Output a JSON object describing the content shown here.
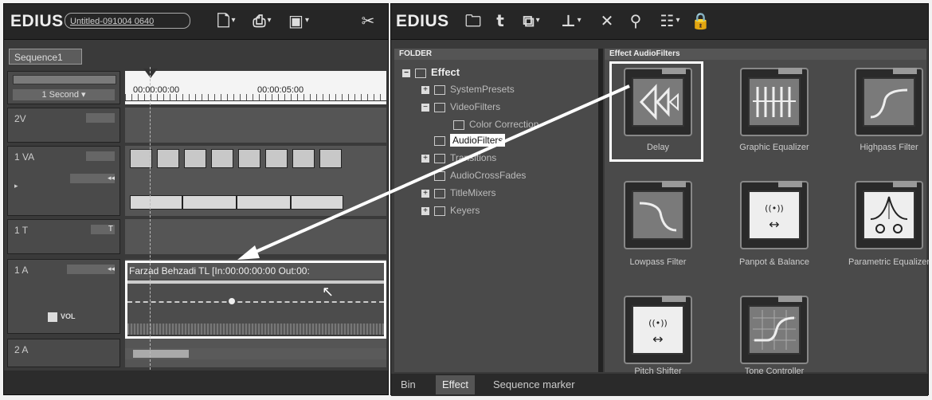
{
  "left_window": {
    "app_title": "EDIUS",
    "project_name": "Untitled-091004 0640",
    "sequence_tab": "Sequence1",
    "scale_label": "1 Second",
    "timecodes": [
      "00:00:00:00",
      "00:00:05:00"
    ],
    "tracks": {
      "t2v": "2V",
      "t1va": "1 VA",
      "t1t": "1 T",
      "t1a": "1 A",
      "t2a": "2 A"
    },
    "vol_label": "VOL",
    "clip_label": "Farzad Behzadi  TL [In:00:00:00:00 Out:00:"
  },
  "right_window": {
    "app_title": "EDIUS",
    "folder_header": "FOLDER",
    "tree": {
      "effect": "Effect",
      "system_presets": "SystemPresets",
      "video_filters": "VideoFilters",
      "color_correction": "Color Correction",
      "audio_filters": "AudioFilters",
      "transitions": "Transitions",
      "audio_cross_fades": "AudioCrossFades",
      "title_mixers": "TitleMixers",
      "keyers": "Keyers"
    },
    "effects_header": "Effect AudioFilters",
    "effects": {
      "delay": "Delay",
      "graphic_equalizer": "Graphic Equalizer",
      "highpass_filter": "Highpass Filter",
      "lowpass_filter": "Lowpass Filter",
      "panpot_balance": "Panpot & Balance",
      "parametric_equalizer": "Parametric Equalizer",
      "pitch_shifter": "Pitch Shifter",
      "tone_controller": "Tone Controller"
    },
    "bottom_tabs": {
      "bin": "Bin",
      "effect": "Effect",
      "sequence_marker": "Sequence marker"
    }
  }
}
